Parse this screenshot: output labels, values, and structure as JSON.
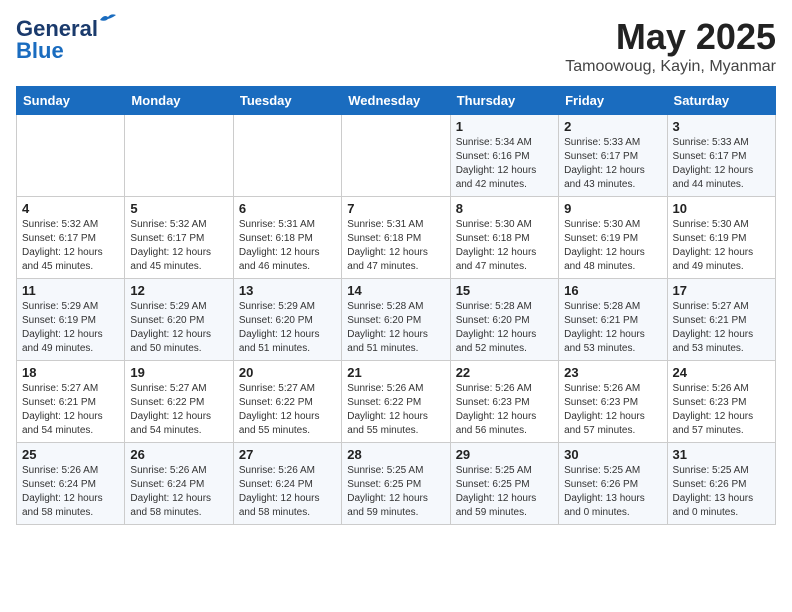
{
  "header": {
    "logo_line1": "General",
    "logo_line2": "Blue",
    "month_year": "May 2025",
    "location": "Tamoowoug, Kayin, Myanmar"
  },
  "days_of_week": [
    "Sunday",
    "Monday",
    "Tuesday",
    "Wednesday",
    "Thursday",
    "Friday",
    "Saturday"
  ],
  "weeks": [
    [
      {
        "day": "",
        "content": ""
      },
      {
        "day": "",
        "content": ""
      },
      {
        "day": "",
        "content": ""
      },
      {
        "day": "",
        "content": ""
      },
      {
        "day": "1",
        "content": "Sunrise: 5:34 AM\nSunset: 6:16 PM\nDaylight: 12 hours\nand 42 minutes."
      },
      {
        "day": "2",
        "content": "Sunrise: 5:33 AM\nSunset: 6:17 PM\nDaylight: 12 hours\nand 43 minutes."
      },
      {
        "day": "3",
        "content": "Sunrise: 5:33 AM\nSunset: 6:17 PM\nDaylight: 12 hours\nand 44 minutes."
      }
    ],
    [
      {
        "day": "4",
        "content": "Sunrise: 5:32 AM\nSunset: 6:17 PM\nDaylight: 12 hours\nand 45 minutes."
      },
      {
        "day": "5",
        "content": "Sunrise: 5:32 AM\nSunset: 6:17 PM\nDaylight: 12 hours\nand 45 minutes."
      },
      {
        "day": "6",
        "content": "Sunrise: 5:31 AM\nSunset: 6:18 PM\nDaylight: 12 hours\nand 46 minutes."
      },
      {
        "day": "7",
        "content": "Sunrise: 5:31 AM\nSunset: 6:18 PM\nDaylight: 12 hours\nand 47 minutes."
      },
      {
        "day": "8",
        "content": "Sunrise: 5:30 AM\nSunset: 6:18 PM\nDaylight: 12 hours\nand 47 minutes."
      },
      {
        "day": "9",
        "content": "Sunrise: 5:30 AM\nSunset: 6:19 PM\nDaylight: 12 hours\nand 48 minutes."
      },
      {
        "day": "10",
        "content": "Sunrise: 5:30 AM\nSunset: 6:19 PM\nDaylight: 12 hours\nand 49 minutes."
      }
    ],
    [
      {
        "day": "11",
        "content": "Sunrise: 5:29 AM\nSunset: 6:19 PM\nDaylight: 12 hours\nand 49 minutes."
      },
      {
        "day": "12",
        "content": "Sunrise: 5:29 AM\nSunset: 6:20 PM\nDaylight: 12 hours\nand 50 minutes."
      },
      {
        "day": "13",
        "content": "Sunrise: 5:29 AM\nSunset: 6:20 PM\nDaylight: 12 hours\nand 51 minutes."
      },
      {
        "day": "14",
        "content": "Sunrise: 5:28 AM\nSunset: 6:20 PM\nDaylight: 12 hours\nand 51 minutes."
      },
      {
        "day": "15",
        "content": "Sunrise: 5:28 AM\nSunset: 6:20 PM\nDaylight: 12 hours\nand 52 minutes."
      },
      {
        "day": "16",
        "content": "Sunrise: 5:28 AM\nSunset: 6:21 PM\nDaylight: 12 hours\nand 53 minutes."
      },
      {
        "day": "17",
        "content": "Sunrise: 5:27 AM\nSunset: 6:21 PM\nDaylight: 12 hours\nand 53 minutes."
      }
    ],
    [
      {
        "day": "18",
        "content": "Sunrise: 5:27 AM\nSunset: 6:21 PM\nDaylight: 12 hours\nand 54 minutes."
      },
      {
        "day": "19",
        "content": "Sunrise: 5:27 AM\nSunset: 6:22 PM\nDaylight: 12 hours\nand 54 minutes."
      },
      {
        "day": "20",
        "content": "Sunrise: 5:27 AM\nSunset: 6:22 PM\nDaylight: 12 hours\nand 55 minutes."
      },
      {
        "day": "21",
        "content": "Sunrise: 5:26 AM\nSunset: 6:22 PM\nDaylight: 12 hours\nand 55 minutes."
      },
      {
        "day": "22",
        "content": "Sunrise: 5:26 AM\nSunset: 6:23 PM\nDaylight: 12 hours\nand 56 minutes."
      },
      {
        "day": "23",
        "content": "Sunrise: 5:26 AM\nSunset: 6:23 PM\nDaylight: 12 hours\nand 57 minutes."
      },
      {
        "day": "24",
        "content": "Sunrise: 5:26 AM\nSunset: 6:23 PM\nDaylight: 12 hours\nand 57 minutes."
      }
    ],
    [
      {
        "day": "25",
        "content": "Sunrise: 5:26 AM\nSunset: 6:24 PM\nDaylight: 12 hours\nand 58 minutes."
      },
      {
        "day": "26",
        "content": "Sunrise: 5:26 AM\nSunset: 6:24 PM\nDaylight: 12 hours\nand 58 minutes."
      },
      {
        "day": "27",
        "content": "Sunrise: 5:26 AM\nSunset: 6:24 PM\nDaylight: 12 hours\nand 58 minutes."
      },
      {
        "day": "28",
        "content": "Sunrise: 5:25 AM\nSunset: 6:25 PM\nDaylight: 12 hours\nand 59 minutes."
      },
      {
        "day": "29",
        "content": "Sunrise: 5:25 AM\nSunset: 6:25 PM\nDaylight: 12 hours\nand 59 minutes."
      },
      {
        "day": "30",
        "content": "Sunrise: 5:25 AM\nSunset: 6:26 PM\nDaylight: 13 hours\nand 0 minutes."
      },
      {
        "day": "31",
        "content": "Sunrise: 5:25 AM\nSunset: 6:26 PM\nDaylight: 13 hours\nand 0 minutes."
      }
    ]
  ]
}
